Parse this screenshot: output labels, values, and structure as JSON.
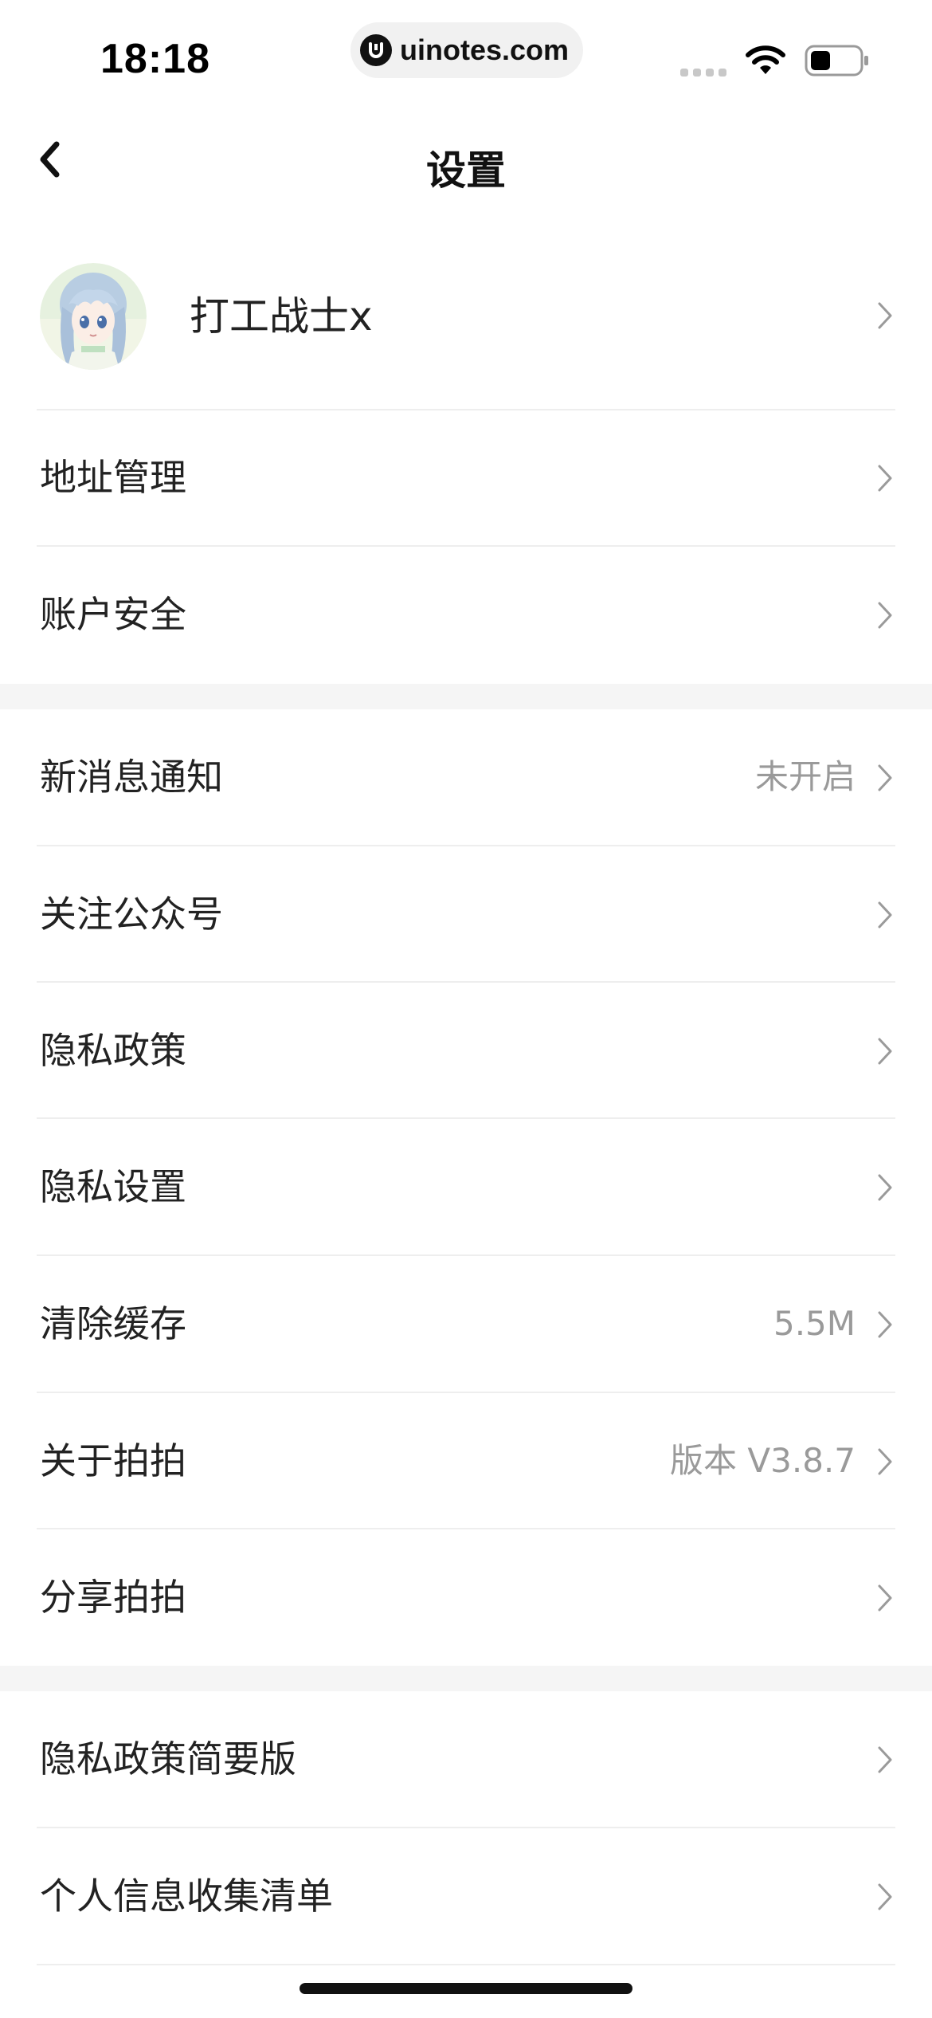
{
  "status_bar": {
    "time": "18:18",
    "url": "uinotes.com"
  },
  "nav": {
    "title": "设置"
  },
  "profile": {
    "name": "打工战士x"
  },
  "section1": [
    {
      "label": "地址管理"
    },
    {
      "label": "账户安全"
    }
  ],
  "section2": [
    {
      "label": "新消息通知",
      "value": "未开启"
    },
    {
      "label": "关注公众号",
      "value": ""
    },
    {
      "label": "隐私政策",
      "value": ""
    },
    {
      "label": "隐私设置",
      "value": ""
    },
    {
      "label": "清除缓存",
      "value": "5.5M"
    },
    {
      "label": "关于拍拍",
      "value": "版本 V3.8.7"
    },
    {
      "label": "分享拍拍",
      "value": ""
    }
  ],
  "section3": [
    {
      "label": "隐私政策简要版"
    },
    {
      "label": "个人信息收集清单"
    }
  ],
  "colors": {
    "separator_band": "#f5f5f5",
    "divider": "#eeeeee",
    "secondary_text": "#9a9a9a"
  }
}
